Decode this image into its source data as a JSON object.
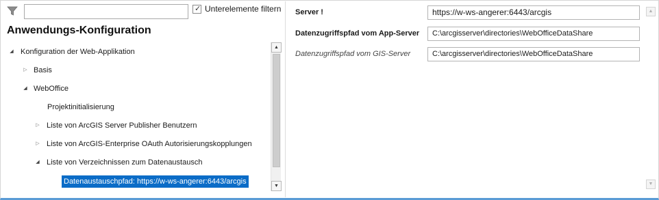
{
  "filter": {
    "input_value": "",
    "checkbox_checked": true,
    "checkbox_label": "Unterelemente filtern"
  },
  "panel": {
    "title": "Anwendungs-Konfiguration"
  },
  "tree": {
    "items": [
      {
        "label": "Konfiguration der Web-Applikation",
        "state": "expanded",
        "level": 0
      },
      {
        "label": "Basis",
        "state": "collapsed",
        "level": 1
      },
      {
        "label": "WebOffice",
        "state": "expanded",
        "level": 1
      },
      {
        "label": "Projektinitialisierung",
        "state": "leaf",
        "level": 2
      },
      {
        "label": "Liste von ArcGIS Server Publisher Benutzern",
        "state": "collapsed",
        "level": 2
      },
      {
        "label": "Liste von ArcGIS-Enterprise OAuth Autorisierungskopplungen",
        "state": "collapsed",
        "level": 2
      },
      {
        "label": "Liste von Verzeichnissen zum Datenaustausch",
        "state": "expanded",
        "level": 2
      },
      {
        "label": "Datenaustauschpfad: https://w-ws-angerer:6443/arcgis",
        "state": "leaf",
        "level": 3,
        "selected": true
      }
    ]
  },
  "properties": [
    {
      "label": "Server !",
      "style": "bold",
      "value": "https://w-ws-angerer:6443/arcgis"
    },
    {
      "label": "Datenzugriffspfad vom App-Server",
      "style": "bold",
      "value": "C:\\arcgisserver\\directories\\WebOfficeDataShare"
    },
    {
      "label": "Datenzugriffspfad vom GIS-Server",
      "style": "italic",
      "value": "C:\\arcgisserver\\directories\\WebOfficeDataShare"
    }
  ],
  "icons": {
    "filter": "funnel-icon",
    "scroll_up": "arrow-up-icon",
    "scroll_down": "arrow-down-icon"
  },
  "colors": {
    "selection": "#0b6cc7",
    "bottom_accent": "#5a9bd5"
  }
}
